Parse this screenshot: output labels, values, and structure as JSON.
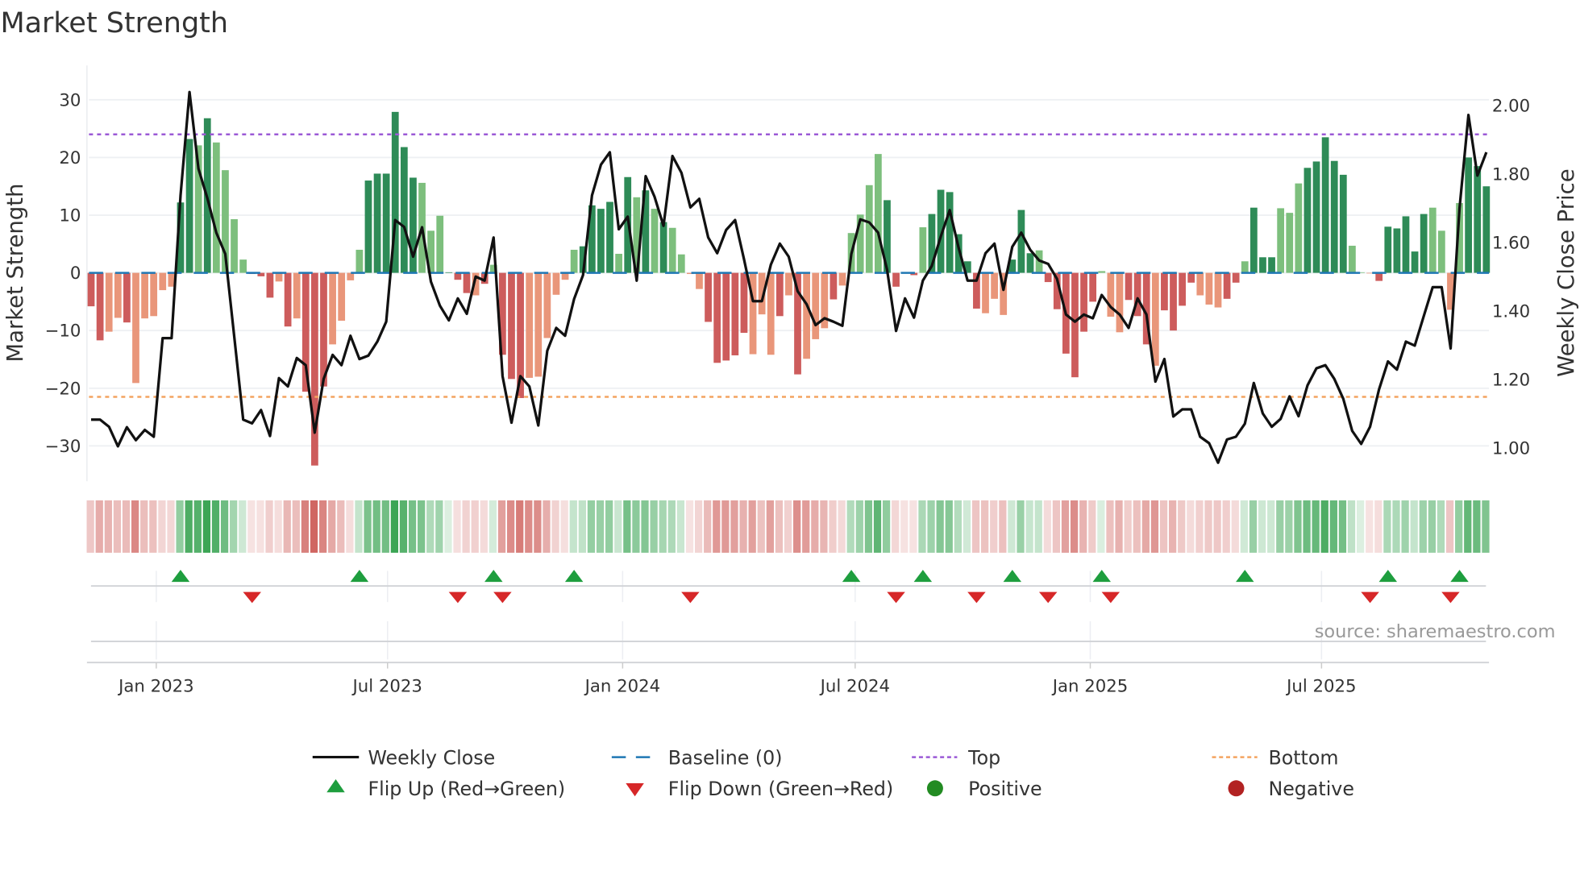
{
  "title": "Market Strength",
  "source": "source: sharemaestro.com",
  "colors": {
    "green_dark": "#2e8b57",
    "green_light": "#7dbf7d",
    "red_dark": "#cd5c5c",
    "red_light": "#e9967a",
    "line": "#111111",
    "baseline": "#1f77b4",
    "top": "#9b59d6",
    "bottom": "#f4a460",
    "flip_up": "#1e9e3e",
    "flip_down": "#d62728",
    "positive": "#228b22",
    "negative": "#b22222"
  },
  "legend": [
    {
      "label": "Weekly Close",
      "icon": "solid-line"
    },
    {
      "label": "Baseline (0)",
      "icon": "dashed-line"
    },
    {
      "label": "Top",
      "icon": "dotted-line"
    },
    {
      "label": "Bottom",
      "icon": "dotted-line"
    },
    {
      "label": "Flip Up (Red→Green)",
      "icon": "triangle-up"
    },
    {
      "label": "Flip Down (Green→Red)",
      "icon": "triangle-down"
    },
    {
      "label": "Positive",
      "icon": "circle"
    },
    {
      "label": "Negative",
      "icon": "circle"
    }
  ],
  "chart_data": {
    "type": "bar+line",
    "title": "Market Strength",
    "ylabel": "Market Strength",
    "y2label": "Weekly Close Price",
    "ylim": [
      -36,
      36
    ],
    "y2lim": [
      0.9,
      2.1
    ],
    "yticks": [
      30,
      20,
      10,
      0,
      -10,
      -20,
      -30
    ],
    "ytick_labels": [
      "30",
      "20",
      "10",
      "0",
      "−10",
      "−20",
      "−30"
    ],
    "y2ticks": [
      2.0,
      1.8,
      1.6,
      1.4,
      1.2,
      1.0
    ],
    "y2tick_labels": [
      "2.00",
      "1.80",
      "1.60",
      "1.40",
      "1.20",
      "1.00"
    ],
    "x_start": "2022-11-11",
    "x_step_days": 7,
    "xticks": [
      {
        "date": "2023-01-01",
        "label": "Jan 2023"
      },
      {
        "date": "2023-07-01",
        "label": "Jul 2023"
      },
      {
        "date": "2024-01-01",
        "label": "Jan 2024"
      },
      {
        "date": "2024-07-01",
        "label": "Jul 2024"
      },
      {
        "date": "2025-01-01",
        "label": "Jan 2025"
      },
      {
        "date": "2025-07-01",
        "label": "Jul 2025"
      }
    ],
    "top_level": 24,
    "bottom_level": -21.5,
    "baseline": 0,
    "strength": [
      -5.8,
      -11.7,
      -10.2,
      -7.8,
      -8.6,
      -19.1,
      -7.9,
      -7.5,
      -3.0,
      -2.4,
      12.2,
      23.2,
      22.1,
      26.8,
      22.6,
      17.8,
      9.3,
      2.3,
      -0.2,
      -0.6,
      -4.3,
      -1.5,
      -9.3,
      -7.9,
      -20.6,
      -33.4,
      -19.7,
      -12.4,
      -8.3,
      -1.3,
      4.0,
      16.0,
      17.2,
      17.2,
      27.9,
      21.8,
      16.5,
      15.6,
      7.3,
      9.9,
      0.1,
      -1.2,
      -3.5,
      -3.9,
      -1.9,
      1.4,
      -14.2,
      -18.4,
      -21.7,
      -18.2,
      -18.0,
      -11.3,
      -3.8,
      -1.2,
      4.0,
      4.6,
      11.7,
      11.1,
      12.3,
      3.3,
      16.6,
      13.1,
      14.3,
      11.1,
      8.8,
      7.8,
      3.2,
      -0.2,
      -2.8,
      -8.5,
      -15.6,
      -15.2,
      -14.3,
      -10.4,
      -14.1,
      -7.2,
      -14.2,
      -7.5,
      -3.9,
      -17.6,
      -14.9,
      -11.5,
      -9.6,
      -4.6,
      -2.2,
      6.9,
      10.1,
      15.2,
      20.6,
      12.6,
      -2.4,
      -0.1,
      -0.4,
      7.9,
      10.2,
      14.4,
      14.0,
      6.7,
      2.0,
      -6.2,
      -7.0,
      -4.5,
      -7.3,
      2.3,
      10.9,
      3.4,
      3.9,
      -1.6,
      -6.3,
      -14.0,
      -18.1,
      -10.2,
      -5.0,
      0.3,
      -7.6,
      -10.3,
      -4.7,
      -7.5,
      -12.4,
      -16.1,
      -6.5,
      -10.0,
      -5.7,
      -1.7,
      -3.9,
      -5.5,
      -6.0,
      -4.5,
      -1.7,
      2.0,
      11.3,
      2.7,
      2.7,
      11.2,
      10.4,
      15.5,
      18.2,
      19.3,
      23.5,
      19.4,
      17.0,
      4.7,
      0.1,
      -0.1,
      -1.4,
      8.0,
      7.7,
      9.8,
      3.7,
      10.2,
      11.3,
      7.3,
      -6.4,
      12.1,
      20.0,
      18.5,
      15.0
    ],
    "shade": "ddlldlllllddldlllldddldldddllllddddddllldddldldddllllllddddldldldlllldddddllldldllldlllllddddlddddddllldddlddddddllldddlddddlllddldddllldddddlllddddddlllldddlddd",
    "weekly_close": [
      1.083,
      1.083,
      1.062,
      1.005,
      1.061,
      1.023,
      1.053,
      1.033,
      1.321,
      1.321,
      1.738,
      2.04,
      1.816,
      1.73,
      1.629,
      1.567,
      1.326,
      1.083,
      1.072,
      1.111,
      1.035,
      1.204,
      1.18,
      1.263,
      1.242,
      1.045,
      1.202,
      1.272,
      1.242,
      1.328,
      1.26,
      1.27,
      1.311,
      1.369,
      1.666,
      1.646,
      1.559,
      1.645,
      1.486,
      1.416,
      1.373,
      1.437,
      1.392,
      1.501,
      1.489,
      1.615,
      1.21,
      1.074,
      1.21,
      1.18,
      1.066,
      1.284,
      1.351,
      1.328,
      1.435,
      1.505,
      1.738,
      1.828,
      1.864,
      1.639,
      1.676,
      1.489,
      1.794,
      1.734,
      1.649,
      1.853,
      1.804,
      1.703,
      1.728,
      1.615,
      1.569,
      1.637,
      1.666,
      1.552,
      1.429,
      1.429,
      1.536,
      1.597,
      1.559,
      1.458,
      1.42,
      1.359,
      1.379,
      1.369,
      1.357,
      1.567,
      1.668,
      1.659,
      1.629,
      1.521,
      1.342,
      1.437,
      1.381,
      1.489,
      1.532,
      1.618,
      1.695,
      1.584,
      1.489,
      1.489,
      1.569,
      1.597,
      1.462,
      1.588,
      1.629,
      1.579,
      1.548,
      1.538,
      1.494,
      1.39,
      1.369,
      1.39,
      1.379,
      1.447,
      1.412,
      1.39,
      1.351,
      1.437,
      1.39,
      1.194,
      1.26,
      1.092,
      1.113,
      1.113,
      1.033,
      1.014,
      0.957,
      1.025,
      1.033,
      1.071,
      1.19,
      1.101,
      1.062,
      1.085,
      1.151,
      1.093,
      1.183,
      1.233,
      1.242,
      1.202,
      1.144,
      1.05,
      1.012,
      1.062,
      1.171,
      1.253,
      1.229,
      1.311,
      1.299,
      1.385,
      1.47,
      1.47,
      1.291,
      1.699,
      1.973,
      1.796,
      1.864
    ],
    "flip_up_weeks": [
      11,
      31,
      46,
      55,
      86,
      94,
      104,
      114,
      130,
      146,
      154
    ],
    "flip_down_weeks": [
      19,
      42,
      47,
      68,
      91,
      100,
      108,
      115,
      144,
      153
    ]
  }
}
